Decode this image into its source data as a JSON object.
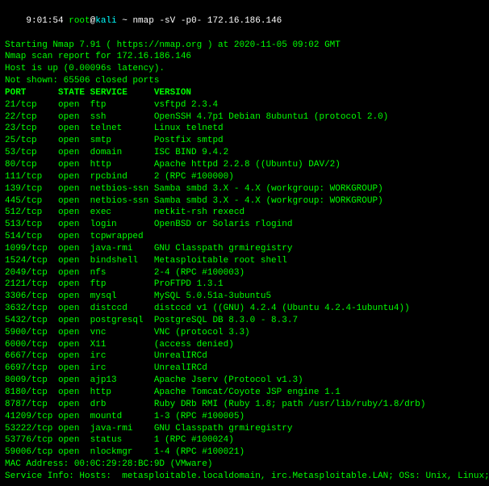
{
  "terminal": {
    "prompt": {
      "time": "9:01:54",
      "user": "root",
      "at": "@",
      "host": "kali",
      "tilde": " ~ ",
      "command": "nmap -sV -p0- 172.16.186.146"
    },
    "lines": [
      "Starting Nmap 7.91 ( https://nmap.org ) at 2020-11-05 09:02 GMT",
      "Nmap scan report for 172.16.186.146",
      "Host is up (0.00096s latency).",
      "Not shown: 65506 closed ports",
      "PORT      STATE SERVICE     VERSION",
      "21/tcp    open  ftp         vsftpd 2.3.4",
      "22/tcp    open  ssh         OpenSSH 4.7p1 Debian 8ubuntu1 (protocol 2.0)",
      "23/tcp    open  telnet      Linux telnetd",
      "25/tcp    open  smtp        Postfix smtpd",
      "53/tcp    open  domain      ISC BIND 9.4.2",
      "80/tcp    open  http        Apache httpd 2.2.8 ((Ubuntu) DAV/2)",
      "111/tcp   open  rpcbind     2 (RPC #100000)",
      "139/tcp   open  netbios-ssn Samba smbd 3.X - 4.X (workgroup: WORKGROUP)",
      "445/tcp   open  netbios-ssn Samba smbd 3.X - 4.X (workgroup: WORKGROUP)",
      "512/tcp   open  exec        netkit-rsh rexecd",
      "513/tcp   open  login       OpenBSD or Solaris rlogind",
      "514/tcp   open  tcpwrapped",
      "1099/tcp  open  java-rmi    GNU Classpath grmiregistry",
      "1524/tcp  open  bindshell   Metasploitable root shell",
      "2049/tcp  open  nfs         2-4 (RPC #100003)",
      "2121/tcp  open  ftp         ProFTPD 1.3.1",
      "3306/tcp  open  mysql       MySQL 5.0.51a-3ubuntu5",
      "3632/tcp  open  distccd     distccd v1 ((GNU) 4.2.4 (Ubuntu 4.2.4-1ubuntu4))",
      "5432/tcp  open  postgresql  PostgreSQL DB 8.3.0 - 8.3.7",
      "5900/tcp  open  vnc         VNC (protocol 3.3)",
      "6000/tcp  open  X11         (access denied)",
      "6667/tcp  open  irc         UnrealIRCd",
      "6697/tcp  open  irc         UnrealIRCd",
      "8009/tcp  open  ajp13       Apache Jserv (Protocol v1.3)",
      "8180/tcp  open  http        Apache Tomcat/Coyote JSP engine 1.1",
      "8787/tcp  open  drb         Ruby DRb RMI (Ruby 1.8; path /usr/lib/ruby/1.8/drb)",
      "41209/tcp open  mountd      1-3 (RPC #100005)",
      "53222/tcp open  java-rmi    GNU Classpath grmiregistry",
      "53776/tcp open  status      1 (RPC #100024)",
      "59006/tcp open  nlockmgr    1-4 (RPC #100021)",
      "MAC Address: 00:0C:29:28:BC:9D (VMware)",
      "Service Info: Hosts:  metasploitable.localdomain, irc.Metasploitable.LAN; OSs: Unix, Linux;"
    ]
  }
}
